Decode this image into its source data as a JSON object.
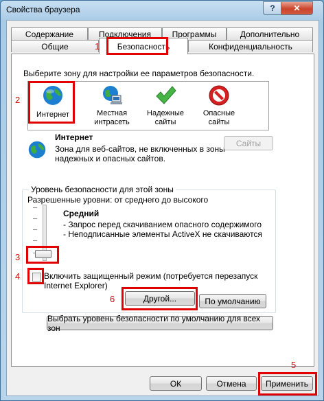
{
  "window": {
    "title": "Свойства браузера",
    "help_label": "?",
    "close_label": "✕"
  },
  "tabs_row1": [
    "Содержание",
    "Подключения",
    "Программы",
    "Дополнительно"
  ],
  "tabs_row2": [
    "Общие",
    "Безопасность",
    "Конфиденциальность"
  ],
  "zones": {
    "prompt": "Выберите зону для настройки ее параметров безопасности.",
    "items": [
      {
        "label": "Интернет",
        "icon": "globe-icon"
      },
      {
        "label": "Местная\nинтрасеть",
        "icon": "intranet-icon"
      },
      {
        "label": "Надежные\nсайты",
        "icon": "checkmark-icon"
      },
      {
        "label": "Опасные\nсайты",
        "icon": "restricted-icon"
      }
    ]
  },
  "zone_info": {
    "title": "Интернет",
    "description_line1": "Зона для веб-сайтов, не включенных в зоны",
    "description_line2": "надежных и опасных сайтов.",
    "sites_button": "Сайты"
  },
  "security_level": {
    "legend": "Уровень безопасности для этой зоны",
    "allowed": "Разрешенные уровни: от среднего до высокого",
    "level_name": "Средний",
    "bullet1": "- Запрос перед скачиванием опасного содержимого",
    "bullet2": "- Неподписанные элементы ActiveX не скачиваются"
  },
  "protected_mode": {
    "line1": "Включить защищенный режим (потребуется перезапуск",
    "line2": "Internet Explorer)",
    "checked": false
  },
  "buttons": {
    "custom": "Другой...",
    "default": "По умолчанию",
    "reset_all": "Выбрать уровень безопасности по умолчанию для всех зон",
    "ok": "ОК",
    "cancel": "Отмена",
    "apply": "Применить"
  },
  "annotations": [
    "1",
    "2",
    "3",
    "4",
    "5",
    "6"
  ],
  "colors": {
    "highlight": "#e00000",
    "title_bar": "#b9d5ec",
    "close_button": "#c9442c"
  }
}
